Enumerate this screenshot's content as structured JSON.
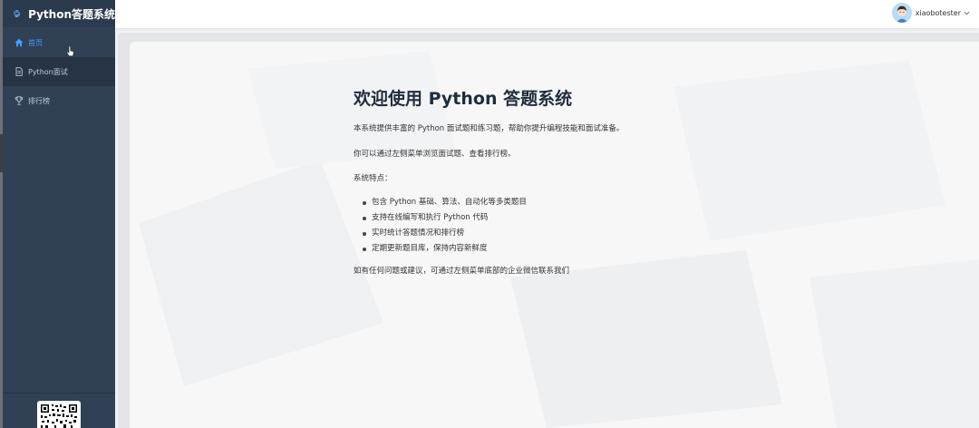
{
  "app": {
    "title": "Python答题系统",
    "logo_icon": "python-logo-icon"
  },
  "sidebar": {
    "items": [
      {
        "label": "首页",
        "icon": "home-icon",
        "active": true
      },
      {
        "label": "Python面试",
        "icon": "document-icon",
        "active": false
      },
      {
        "label": "排行榜",
        "icon": "trophy-icon",
        "active": false
      }
    ],
    "qr_icon": "wechat-qr-code"
  },
  "header": {
    "username": "xiaobotester",
    "avatar_icon": "user-avatar-icon",
    "dropdown_icon": "chevron-down-icon"
  },
  "main": {
    "heading": "欢迎使用 Python 答题系统",
    "intro": "本系统提供丰富的 Python 面试题和练习题，帮助你提升编程技能和面试准备。",
    "nav_hint": "你可以通过左侧菜单浏览面试题、查看排行榜。",
    "features_title": "系统特点：",
    "features": [
      "包含 Python 基础、算法、自动化等多类题目",
      "支持在线编写和执行 Python 代码",
      "实时统计答题情况和排行榜",
      "定期更新题目库，保持内容新鲜度"
    ],
    "contact": "如有任何问题或建议，可通过左侧菜单底部的企业微信联系我们"
  },
  "colors": {
    "sidebar_bg": "#304156",
    "menu_text": "#bfcbd9",
    "menu_active": "#409eff",
    "heading": "#1f2d3d"
  }
}
